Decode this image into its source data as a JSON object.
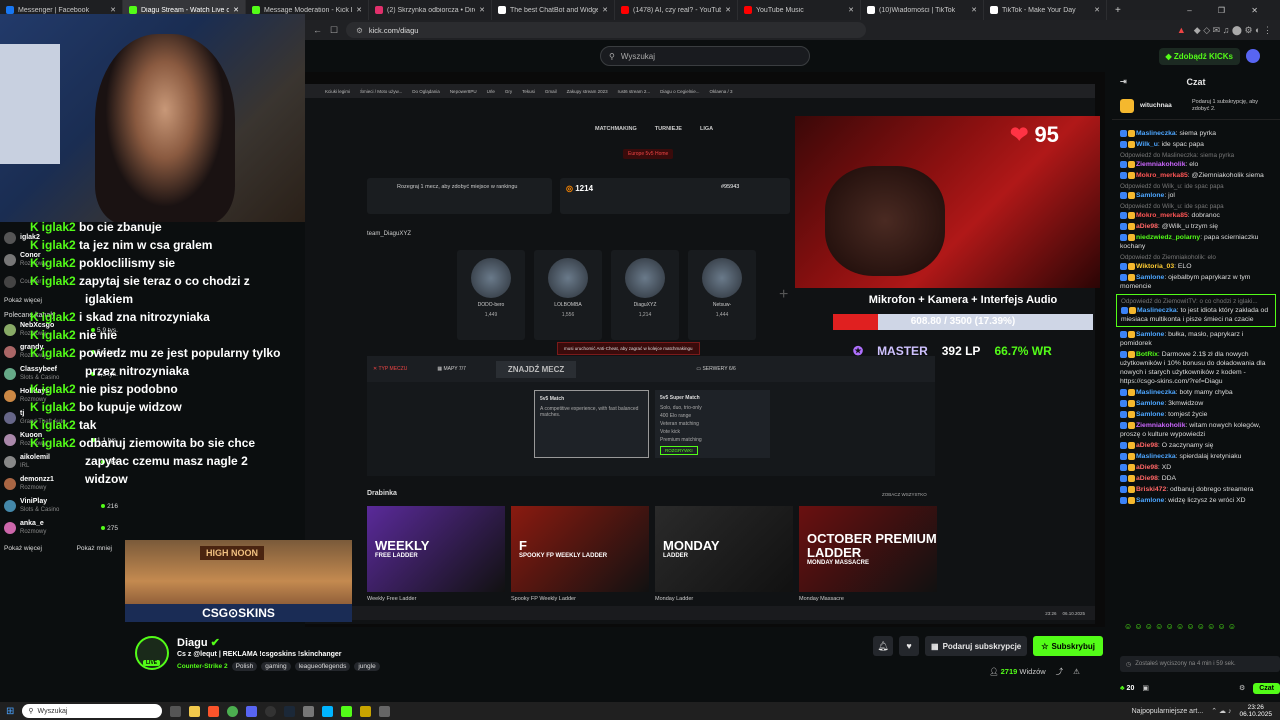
{
  "tabs": [
    {
      "label": "Messenger | Facebook",
      "color": "#1877f2"
    },
    {
      "label": "Diagu Stream - Watch Live o",
      "color": "#53fc18",
      "active": true
    },
    {
      "label": "Message Moderation - Kick Dashbo",
      "color": "#53fc18"
    },
    {
      "label": "(2) Skrzynka odbiorcza • Direct",
      "color": "#e1306c"
    },
    {
      "label": "The best ChatBot and Widgets for K",
      "color": "#ffffff"
    },
    {
      "label": "(1478) AI, czy real? - YouTube",
      "color": "#ff0000"
    },
    {
      "label": "YouTube Music",
      "color": "#ff0000"
    },
    {
      "label": "(10)Wiadomości | TikTok",
      "color": "#ffffff"
    },
    {
      "label": "TikTok - Make Your Day",
      "color": "#ffffff"
    }
  ],
  "address": {
    "url": "kick.com/diagu"
  },
  "site": {
    "search_placeholder": "Wyszukaj",
    "kicks_button": "Zdobądź KICKs"
  },
  "left_sidebar": {
    "channels": [
      {
        "name": "iglak2",
        "sub": "",
        "viewers": "",
        "color": "#555"
      },
      {
        "name": "Conor",
        "sub": "Rozmowy",
        "viewers": "",
        "color": "#777"
      },
      {
        "name": "",
        "sub": "Counter",
        "viewers": "",
        "color": "#444"
      }
    ],
    "show_more_1": "Pokaż więcej",
    "recommended_title": "Polecane kanały",
    "recommended": [
      {
        "name": "NebXcsgo",
        "sub": "Rozmowy",
        "viewers": "5,9 tys.",
        "color": "#8a6"
      },
      {
        "name": "grandy",
        "sub": "Rozmowy",
        "viewers": "5,2 tys.",
        "color": "#a66"
      },
      {
        "name": "Classybeef",
        "sub": "Slots & Casino",
        "viewers": "1,3 tys.",
        "color": "#6a8"
      },
      {
        "name": "Holidays",
        "sub": "Rozmowy",
        "viewers": "",
        "color": "#c84"
      },
      {
        "name": "tj",
        "sub": "Grand Theft Auto",
        "viewers": "",
        "color": "#668"
      },
      {
        "name": "Kuoon",
        "sub": "Rozmowy",
        "viewers": "1,1 tys.",
        "color": "#a8a"
      },
      {
        "name": "aikolemil",
        "sub": "IRL",
        "viewers": "364",
        "color": "#888"
      },
      {
        "name": "demonzz1",
        "sub": "Rozmowy",
        "viewers": "",
        "color": "#a64"
      },
      {
        "name": "ViniPlay",
        "sub": "Slots & Casino",
        "viewers": "216",
        "color": "#48a"
      },
      {
        "name": "anka_e",
        "sub": "Rozmowy",
        "viewers": "275",
        "color": "#c6a"
      }
    ],
    "show_more_2": "Pokaż więcej",
    "show_less": "Pokaż mniej"
  },
  "overlay_chat": [
    {
      "user": "iglak2",
      "text": "bo cie zbanuje"
    },
    {
      "user": "iglak2",
      "text": "ta jez nim w csa gralem"
    },
    {
      "user": "iglak2",
      "text": "pokloclilismy sie"
    },
    {
      "user": "iglak2",
      "text": "zapytaj sie teraz o co chodzi z"
    },
    {
      "user": "",
      "text": "iglakiem"
    },
    {
      "user": "iglak2",
      "text": "i skad zna nitrozyniaka"
    },
    {
      "user": "iglak2",
      "text": "nie nie"
    },
    {
      "user": "iglak2",
      "text": "powiedz mu ze jest popularny tylko"
    },
    {
      "user": "",
      "text": "przez nitrozyniaka"
    },
    {
      "user": "iglak2",
      "text": "nie pisz podobno"
    },
    {
      "user": "iglak2",
      "text": "bo kupuje widzow"
    },
    {
      "user": "iglak2",
      "text": "tak"
    },
    {
      "user": "iglak2",
      "text": "odbanuj ziemowita bo sie chce"
    },
    {
      "user": "",
      "text": "zapytac czemu masz nagle 2"
    },
    {
      "user": "",
      "text": "widzow"
    }
  ],
  "stream_video": {
    "bookmarks": [
      "Kciuki legimi",
      "Śmieci / Moto używ...",
      "Do Oglądania",
      "Nepower8PU",
      "Urle",
      "Gry",
      "Tekusi",
      "Gmail",
      "Zakupy stream 2023",
      "rust6 stream 2...",
      "Diagu o Cegielnie...",
      "Oklaena / 3"
    ],
    "nav": [
      "MATCHMAKING",
      "TURNIEJE",
      "LIGA"
    ],
    "region": "Europe 5v5 Home",
    "team_name": "team_DiaguXYZ",
    "rank_box": "Rozegraj 1 mecz, aby zdobyć miejsce w rankingu",
    "elo": "1214",
    "rank_pos": "#95943",
    "players": [
      {
        "name": "DODO-bero",
        "elo": "1,449"
      },
      {
        "name": "LOLBOMBA",
        "elo": "1,556"
      },
      {
        "name": "DiaguXYZ",
        "elo": "1,214"
      },
      {
        "name": "Netsuw-",
        "elo": "1,444"
      }
    ],
    "anticheat_msg": "musi uruchomić Anti-Cheat, aby zagrać w kolejce matchmakingu",
    "mode_label": "TYP MECZU",
    "maps_label": "MAPY 7/7",
    "find_match": "ZNAJDŹ MECZ",
    "servers": "SERWERY 6/6",
    "match1_title": "5v5 Match",
    "match1_desc": "A competitive experience, with fast balanced matches.",
    "match2_title": "5v5 Super Match",
    "match2_items": [
      "Solo, duo, trio-only",
      "400 Elo range",
      "Veteran matching",
      "Vote kick",
      "Premium matching"
    ],
    "match2_cta": "ROZGRYWKI",
    "ladder_title": "Drabinka",
    "ladder_all": "ZOBACZ WSZYSTKO",
    "ladders": [
      {
        "card_title": "WEEKLY",
        "card_sub": "FREE LADDER",
        "caption": "Weekly Free Ladder",
        "color": "#5a2a9a"
      },
      {
        "card_title": "F",
        "card_sub": "SPOOKY FP WEEKLY LADDER",
        "caption": "Spooky FP Weekly Ladder",
        "color": "#8a1a10"
      },
      {
        "card_title": "MONDAY",
        "card_sub": "LADDER",
        "caption": "Monday Ladder",
        "color": "#2a2a2a"
      },
      {
        "card_title": "OCTOBER PREMIUM LADDER",
        "card_sub": "MONDAY MASSACRE",
        "caption": "Monday Massacre",
        "color": "#6a1010"
      }
    ],
    "heart_rate": "95",
    "goal_title": "Mikrofon + Kamera + Interfejs Audio",
    "goal_text": "608.80 / 3500 (17.39%)",
    "goal_fraction": 0.1739,
    "rank_badge": "MASTER",
    "lp": "392 LP",
    "winrate": "66.7% WR",
    "time": "23:26",
    "date": "06.10.2025"
  },
  "ad": {
    "title": "HIGH NOON",
    "brand": "CSG⊙SKINS"
  },
  "stream_meta": {
    "streamer": "Diagu",
    "live_badge": "LIVE",
    "title": "Cs z @lequt | REKLAMA !csgoskins !skinchanger",
    "category": "Counter-Strike 2",
    "tags": [
      "Polish",
      "gaming",
      "leagueoflegends",
      "jungle"
    ],
    "subscribe_gift": "Podaruj subskrypcje",
    "subscribe": "Subskrybuj",
    "viewers": "2719",
    "viewers_label": "Widzów"
  },
  "chat": {
    "title": "Czat",
    "pinned_user": "wituchnaa",
    "pinned_text": "Podaruj 1 subskrypcję, aby zdobyć 2.",
    "messages": [
      {
        "reply": "",
        "user": "Maslineczka",
        "text": "siema pyrka",
        "color": "#4da6ff"
      },
      {
        "reply": "",
        "user": "Wilk_u",
        "text": "ide spac papa",
        "color": "#4da6ff"
      },
      {
        "reply": "Odpowiedź do Maslineczka: siema pyrka",
        "user": "Ziemniakoholik",
        "text": "elo",
        "color": "#cc66ff"
      },
      {
        "reply": "",
        "user": "Mokro_merka85",
        "text": "@Ziemniakoholik siema",
        "color": "#ff5555"
      },
      {
        "reply": "Odpowiedź do Wilk_u: ide spac papa",
        "user": "Samlone",
        "text": "jol",
        "color": "#4da6ff"
      },
      {
        "reply": "Odpowiedź do Wilk_u: ide spac papa",
        "user": "Mokro_merka85",
        "text": "dobranoc",
        "color": "#ff5555"
      },
      {
        "reply": "",
        "user": "aDie98",
        "text": "@Wilk_u trzym się",
        "color": "#ff6666"
      },
      {
        "reply": "",
        "user": "niedzwiedz_polarny",
        "text": "papa scierniaczku kochany",
        "color": "#53fc18"
      },
      {
        "reply": "Odpowiedź do Ziemniakoholik: elo",
        "user": "Wiktoria_03",
        "text": "ELO",
        "color": "#ffcc33"
      },
      {
        "reply": "",
        "user": "Samlone",
        "text": "ojebalbym paprykarz w tym momencie",
        "color": "#4da6ff"
      },
      {
        "reply": "Odpowiedź do ZiemowitTV: o co chodzi z iglaki...",
        "user": "Maslineczka",
        "text": "to jest idiota który zakłada od miesiaca multikonta i pisze śmieci na czacie",
        "color": "#4da6ff",
        "highlight": true
      },
      {
        "reply": "",
        "user": "Samlone",
        "text": "bułka, masło, paprykarz i pomidorek",
        "color": "#4da6ff"
      },
      {
        "reply": "",
        "user": "BotRix",
        "text": "Darmowe 2.1$ zł dla nowych użytkowników i 10% bonusu do doładowania dla nowych i starych użytkowników z kodem - https://csgo-skins.com/?ref=Diagu",
        "color": "#53fc18"
      },
      {
        "reply": "",
        "user": "Maslineczka",
        "text": "boty mamy chyba",
        "color": "#4da6ff"
      },
      {
        "reply": "",
        "user": "Samlone",
        "text": "3kmwidzow",
        "color": "#4da6ff"
      },
      {
        "reply": "",
        "user": "Samlone",
        "text": "tomjest życie",
        "color": "#4da6ff"
      },
      {
        "reply": "",
        "user": "Ziemniakoholik",
        "text": "witam nowych kolegów, proszę o kulture wypowiedzi",
        "color": "#cc66ff"
      },
      {
        "reply": "",
        "user": "aDie98",
        "text": "O zaczynamy się",
        "color": "#ff6666"
      },
      {
        "reply": "",
        "user": "Maslineczka",
        "text": "spierdalaj kretyniaku",
        "color": "#4da6ff"
      },
      {
        "reply": "",
        "user": "aDie98",
        "text": "XD",
        "color": "#ff6666"
      },
      {
        "reply": "",
        "user": "aDie98",
        "text": "DDA",
        "color": "#ff6666"
      },
      {
        "reply": "",
        "user": "Briski472",
        "text": "odbanuj dobrego streamera",
        "color": "#ff6666"
      },
      {
        "reply": "",
        "user": "Samlone",
        "text": "widzę liczysz że wróci XD",
        "color": "#4da6ff"
      }
    ],
    "input_placeholder": "Zostałeś wyciszony na 4 min i 59 sek.",
    "points": "20",
    "send": "Czat"
  },
  "taskbar": {
    "search": "Wyszukaj",
    "weather": "Najpopularniejsze art...",
    "time": "23:26",
    "date": "06.10.2025"
  }
}
